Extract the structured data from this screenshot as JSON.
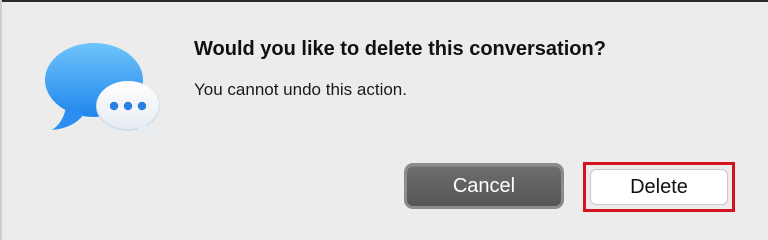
{
  "dialog": {
    "icon": "messages-icon",
    "title": "Would you like to delete this conversation?",
    "message": "You cannot undo this action.",
    "buttons": {
      "cancel_label": "Cancel",
      "delete_label": "Delete"
    },
    "colors": {
      "background": "#ececec",
      "icon_blue": "#2e9bf5",
      "cancel_fill": "#5e5e5e",
      "delete_fill": "#ffffff",
      "highlight": "#d2141f"
    }
  }
}
